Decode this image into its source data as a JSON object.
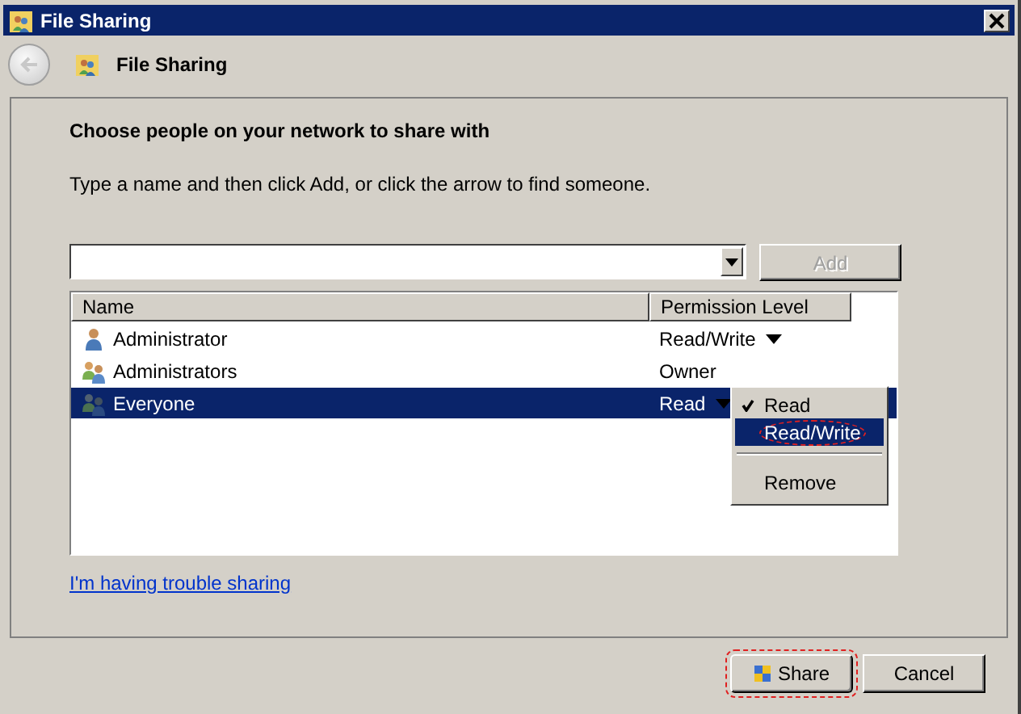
{
  "window": {
    "title": "File Sharing"
  },
  "header": {
    "title": "File Sharing"
  },
  "heading": "Choose people on your network to share with",
  "instruction": "Type a name and then click Add, or click the arrow to find someone.",
  "add_button": {
    "label": "Add",
    "disabled": true
  },
  "table": {
    "columns": [
      "Name",
      "Permission Level"
    ],
    "rows": [
      {
        "name": "Administrator",
        "kind": "user",
        "permission": "Read/Write",
        "has_dropdown": true,
        "selected": false
      },
      {
        "name": "Administrators",
        "kind": "group",
        "permission": "Owner",
        "has_dropdown": false,
        "selected": false
      },
      {
        "name": "Everyone",
        "kind": "everyone",
        "permission": "Read",
        "has_dropdown": true,
        "selected": true
      }
    ]
  },
  "context_menu": {
    "items": [
      {
        "kind": "item",
        "label": "Read",
        "checked": true,
        "selected": false,
        "circled": false
      },
      {
        "kind": "item",
        "label": "Read/Write",
        "checked": false,
        "selected": true,
        "circled": true
      },
      {
        "kind": "separator"
      },
      {
        "kind": "item",
        "label": "Remove",
        "checked": false,
        "selected": false,
        "circled": false
      }
    ]
  },
  "help_link": "I'm having trouble sharing",
  "buttons": [
    {
      "label": "Share",
      "shield": true,
      "circled": true
    },
    {
      "label": "Cancel",
      "shield": false,
      "circled": false
    }
  ]
}
